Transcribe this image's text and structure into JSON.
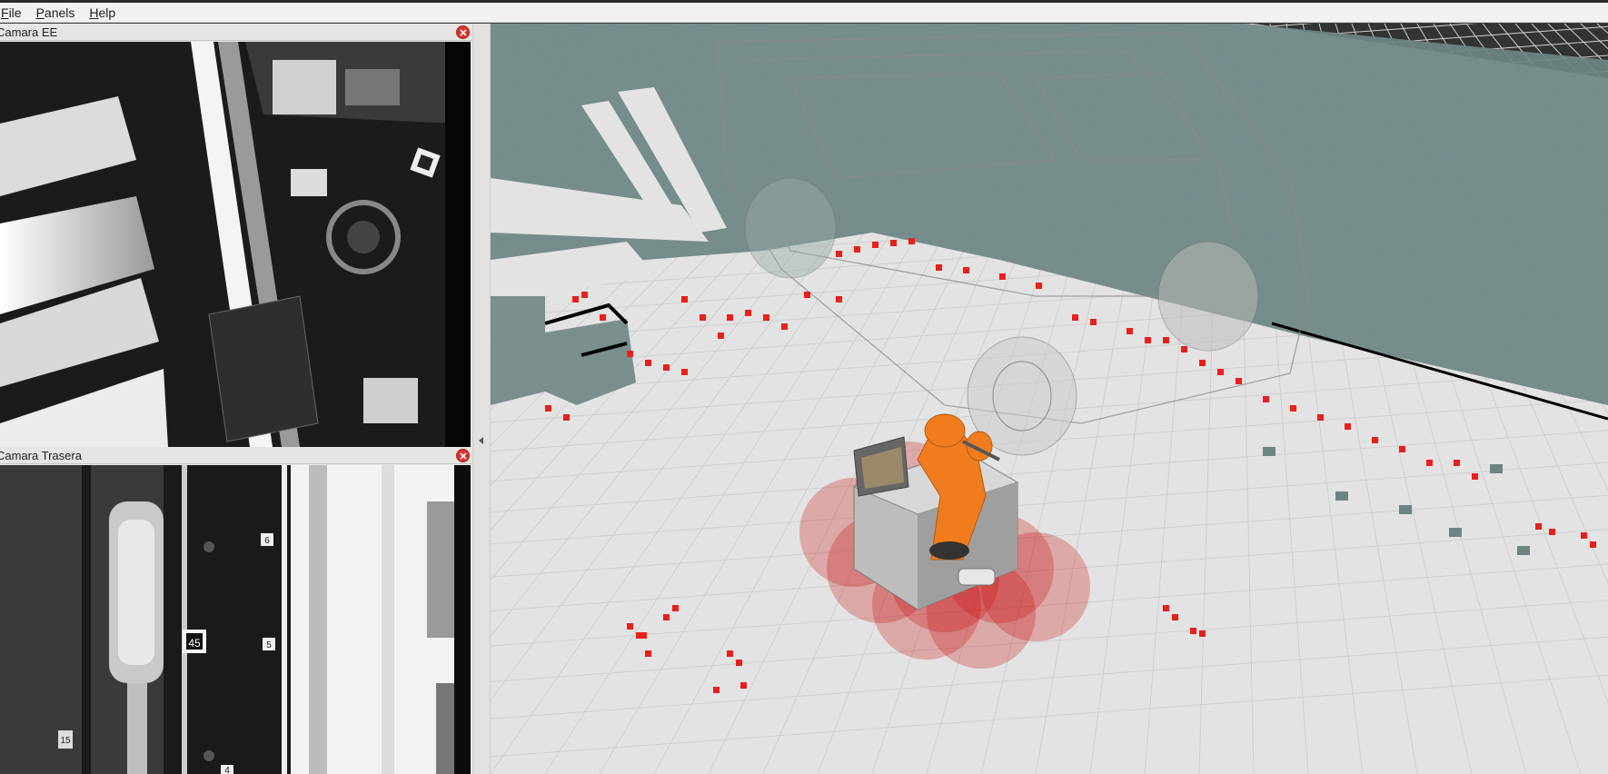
{
  "menubar": {
    "items": [
      {
        "label": "File",
        "mnemonic": "F"
      },
      {
        "label": "Panels",
        "mnemonic": "P"
      },
      {
        "label": "Help",
        "mnemonic": "H"
      }
    ]
  },
  "panels": {
    "camera_ee": {
      "title": "Camara EE"
    },
    "camera_rear": {
      "title": "Camara Trasera"
    }
  },
  "camera_rear_tags": {
    "big_marker": "45",
    "tags": [
      "6",
      "5",
      "4",
      "15"
    ]
  },
  "colors": {
    "map_free": "#e3e3e3",
    "map_unknown": "#6e8584",
    "map_occupied": "#000000",
    "laser_points": "#e8201c",
    "robot_arm": "#f07c1e",
    "safety_zone": "#c81010"
  },
  "icons": {
    "close": "close-icon",
    "splitter": "collapse-left-icon"
  }
}
